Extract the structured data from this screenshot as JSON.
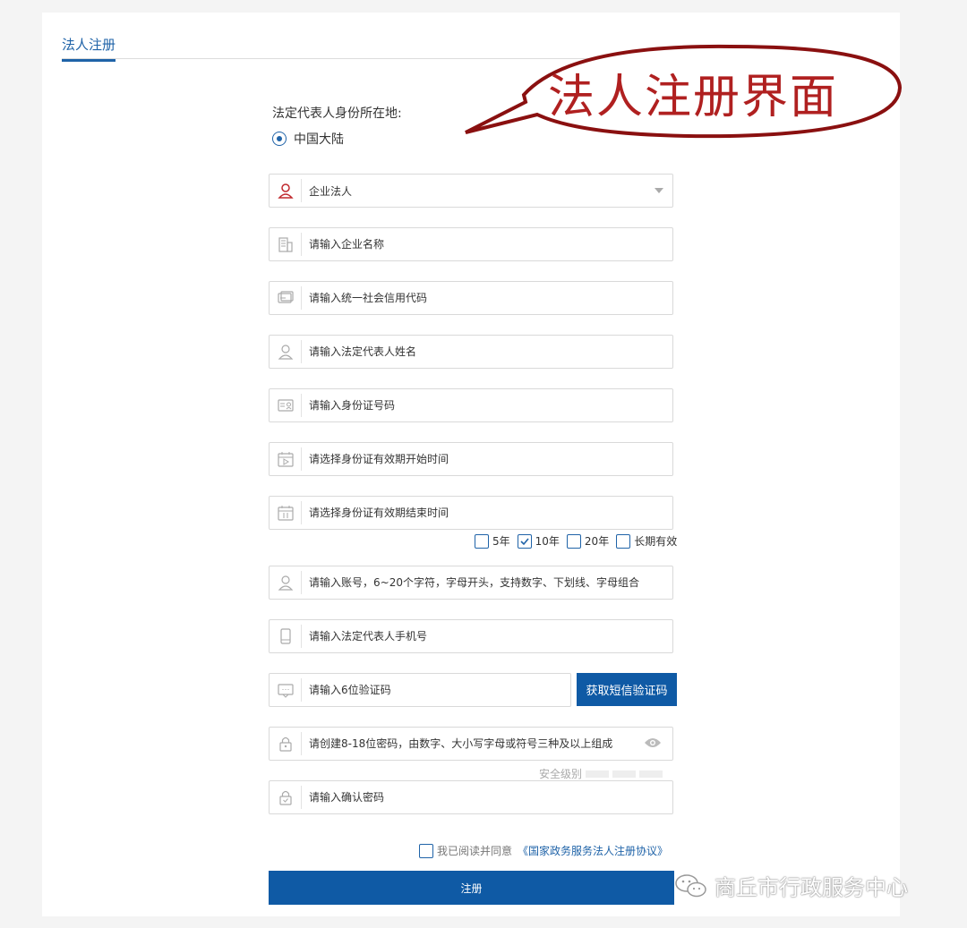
{
  "tab": {
    "label": "法人注册"
  },
  "location": {
    "label": "法定代表人身份所在地:",
    "option": "中国大陆"
  },
  "legal_type": {
    "value": "企业法人"
  },
  "fields": {
    "company_name": "请输入企业名称",
    "credit_code": "请输入统一社会信用代码",
    "rep_name": "请输入法定代表人姓名",
    "id_number": "请输入身份证号码",
    "id_start": "请选择身份证有效期开始时间",
    "id_end": "请选择身份证有效期结束时间",
    "account": "请输入账号，6~20个字符，字母开头，支持数字、下划线、字母组合",
    "phone": "请输入法定代表人手机号",
    "sms_code": "请输入6位验证码",
    "password": "请创建8-18位密码，由数字、大小写字母或符号三种及以上组成",
    "confirm_password": "请输入确认密码"
  },
  "periods": [
    {
      "label": "5年",
      "checked": false
    },
    {
      "label": "10年",
      "checked": true
    },
    {
      "label": "20年",
      "checked": false
    },
    {
      "label": "长期有效",
      "checked": false
    }
  ],
  "sms_button": "获取短信验证码",
  "strength_label": "安全级别",
  "agreement": {
    "prefix": "我已阅读并同意",
    "link": "《国家政务服务法人注册协议》"
  },
  "submit_label": "注册",
  "annotation": "法人注册界面",
  "watermark": "商丘市行政服务中心",
  "colors": {
    "primary": "#0f5aa5",
    "annotation": "#b02020"
  }
}
